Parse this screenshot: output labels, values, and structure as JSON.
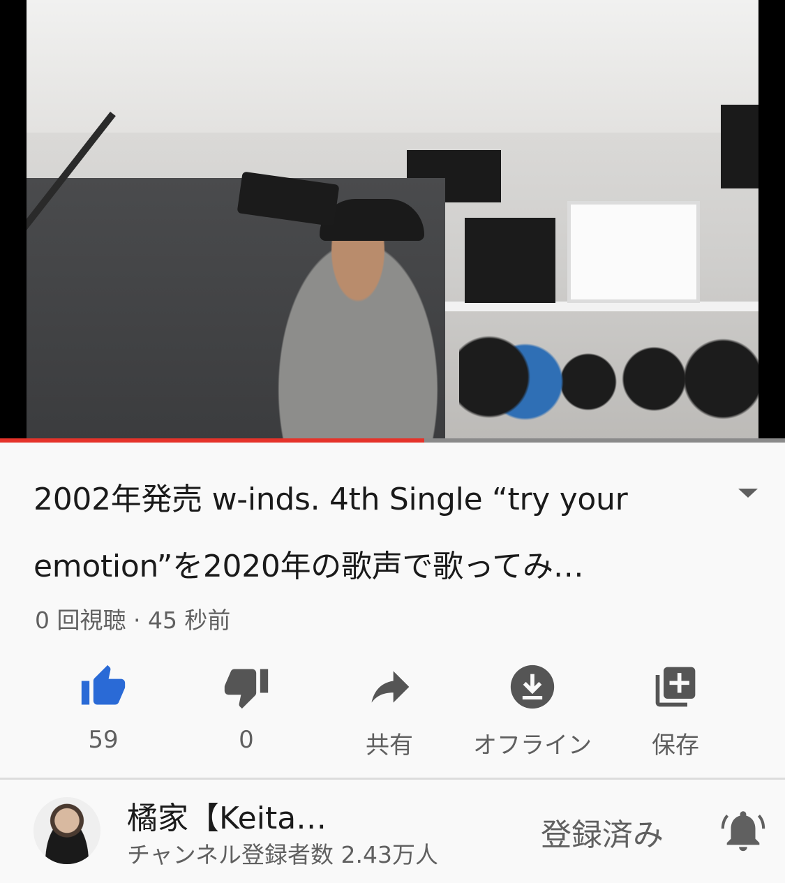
{
  "video": {
    "progress_fraction": 0.54,
    "accent_color": "#e5332a",
    "icon": "video-frame"
  },
  "details": {
    "title": "2002年発売 w-inds. 4th Single “try your emotion”を2020年の歌声で歌ってみ…",
    "meta": "0 回視聴 · 45 秒前",
    "expand_icon": "chevron-down-icon"
  },
  "actions": {
    "like": {
      "label": "59",
      "icon": "thumbs-up-icon",
      "color": "#2a6ad6"
    },
    "dislike": {
      "label": "0",
      "icon": "thumbs-down-icon"
    },
    "share": {
      "label": "共有",
      "icon": "share-icon"
    },
    "offline": {
      "label": "オフライン",
      "icon": "download-icon"
    },
    "save": {
      "label": "保存",
      "icon": "playlist-add-icon"
    }
  },
  "channel": {
    "name": "橘家【Keita…",
    "subscribers": "チャンネル登録者数 2.43万人",
    "subscribe_state": "登録済み",
    "bell_icon": "notification-bell-icon"
  }
}
